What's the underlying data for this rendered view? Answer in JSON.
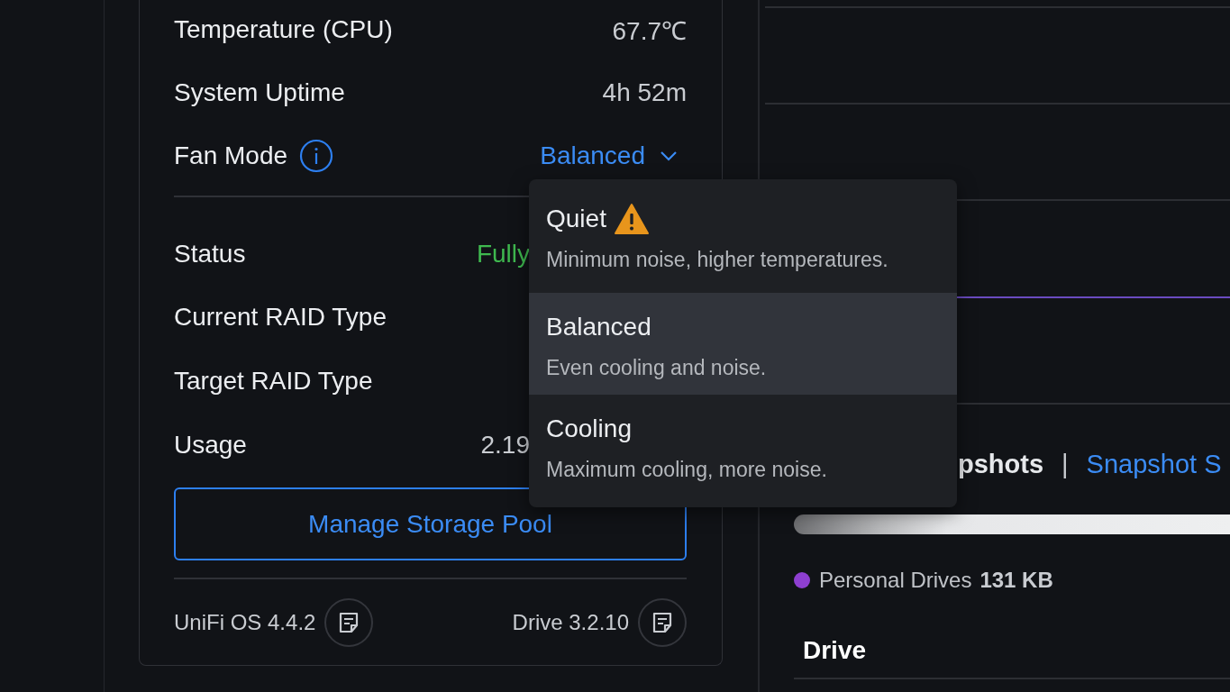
{
  "stats": [
    {
      "label": "Temperature (CPU)",
      "value": "67.7℃"
    },
    {
      "label": "System Uptime",
      "value": "4h 52m"
    }
  ],
  "fan_mode": {
    "label": "Fan Mode",
    "value": "Balanced",
    "expanded": true
  },
  "pool": [
    {
      "label": "Status",
      "value": "Fully",
      "kind": "status"
    },
    {
      "label": "Current RAID Type"
    },
    {
      "label": "Target RAID Type"
    },
    {
      "label": "Usage",
      "value": "2.19",
      "kind": "plain"
    }
  ],
  "manage_button": "Manage Storage Pool",
  "versions": [
    {
      "label": "UniFi OS 4.4.2"
    },
    {
      "label": "Drive 3.2.10"
    }
  ],
  "fan_menu": [
    {
      "title": "Quiet",
      "warning": true,
      "description": "Minimum noise, higher temperatures.",
      "selected": false
    },
    {
      "title": "Balanced",
      "warning": false,
      "description": "Even cooling and noise.",
      "selected": true
    },
    {
      "title": "Cooling",
      "warning": false,
      "description": "Maximum cooling, more noise.",
      "selected": false
    }
  ],
  "snapshots": {
    "tab": "pshots",
    "separator": "|",
    "link": "Snapshot S"
  },
  "legend": [
    {
      "label": "Personal Drives",
      "value": "131 KB",
      "color": "#8e3fd0"
    }
  ],
  "section_title": "Drive"
}
